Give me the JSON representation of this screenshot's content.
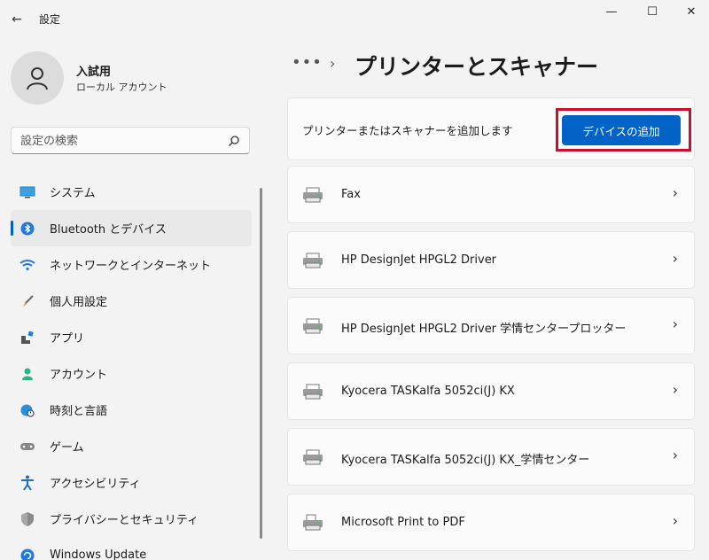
{
  "app": {
    "title": "設定",
    "back_glyph": "←"
  },
  "window": {
    "minimize": "—",
    "maximize": "☐",
    "close": "✕"
  },
  "user": {
    "name": "入試用",
    "account": "ローカル アカウント"
  },
  "search": {
    "placeholder": "設定の検索"
  },
  "nav": {
    "items": [
      {
        "label": "システム",
        "icon": "display-icon",
        "active": false
      },
      {
        "label": "Bluetooth とデバイス",
        "icon": "bluetooth-icon",
        "active": true
      },
      {
        "label": "ネットワークとインターネット",
        "icon": "wifi-icon",
        "active": false
      },
      {
        "label": "個人用設定",
        "icon": "brush-icon",
        "active": false
      },
      {
        "label": "アプリ",
        "icon": "apps-icon",
        "active": false
      },
      {
        "label": "アカウント",
        "icon": "person-icon",
        "active": false
      },
      {
        "label": "時刻と言語",
        "icon": "globe-clock-icon",
        "active": false
      },
      {
        "label": "ゲーム",
        "icon": "gamepad-icon",
        "active": false
      },
      {
        "label": "アクセシビリティ",
        "icon": "accessibility-icon",
        "active": false
      },
      {
        "label": "プライバシーとセキュリティ",
        "icon": "shield-icon",
        "active": false
      },
      {
        "label": "Windows Update",
        "icon": "update-icon",
        "active": false
      }
    ]
  },
  "main": {
    "breadcrumb_more": "•••",
    "breadcrumb_chevron": "›",
    "title": "プリンターとスキャナー",
    "add_text": "プリンターまたはスキャナーを追加します",
    "add_button": "デバイスの追加",
    "devices": [
      {
        "name": "Fax",
        "icon": "fax-icon"
      },
      {
        "name": "HP DesignJet HPGL2 Driver",
        "icon": "printer-icon"
      },
      {
        "name": "HP DesignJet HPGL2 Driver 学情センタープロッター",
        "icon": "printer-icon"
      },
      {
        "name": "Kyocera TASKalfa 5052ci(J) KX",
        "icon": "printer-icon"
      },
      {
        "name": "Kyocera TASKalfa 5052ci(J) KX_学情センター",
        "icon": "printer-icon"
      },
      {
        "name": "Microsoft Print to PDF",
        "icon": "pdf-printer-icon"
      }
    ],
    "chevron": "›"
  },
  "colors": {
    "accent": "#0063c5",
    "highlight_border": "#c8102e"
  }
}
